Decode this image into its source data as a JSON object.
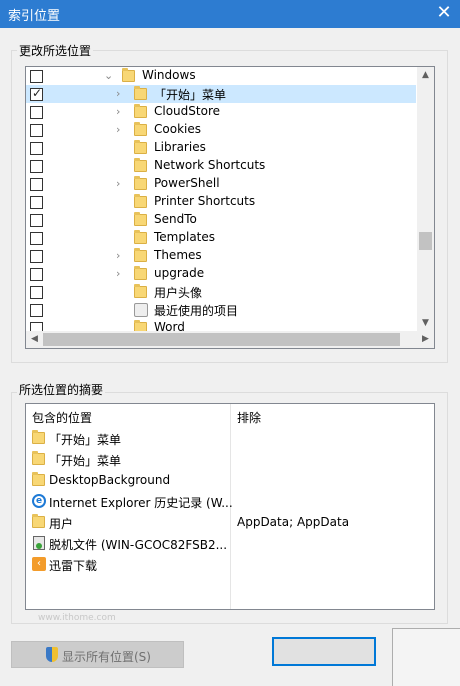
{
  "window": {
    "title": "索引位置",
    "close_glyph": "✕"
  },
  "change_section": {
    "label": "更改所选位置"
  },
  "tree": {
    "items": [
      {
        "label": "Windows",
        "checked": false,
        "expander": "⌄",
        "icon": "folder-icon"
      },
      {
        "label": "「开始」菜单",
        "checked": true,
        "expander": "›",
        "icon": "folder-icon"
      },
      {
        "label": "CloudStore",
        "checked": false,
        "expander": "›",
        "icon": "folder-icon"
      },
      {
        "label": "Cookies",
        "checked": false,
        "expander": "›",
        "icon": "folder-icon"
      },
      {
        "label": "Libraries",
        "checked": false,
        "expander": "",
        "icon": "folder-icon"
      },
      {
        "label": "Network Shortcuts",
        "checked": false,
        "expander": "",
        "icon": "folder-icon"
      },
      {
        "label": "PowerShell",
        "checked": false,
        "expander": "›",
        "icon": "folder-icon"
      },
      {
        "label": "Printer Shortcuts",
        "checked": false,
        "expander": "",
        "icon": "folder-icon"
      },
      {
        "label": "SendTo",
        "checked": false,
        "expander": "",
        "icon": "folder-icon"
      },
      {
        "label": "Templates",
        "checked": false,
        "expander": "",
        "icon": "folder-icon"
      },
      {
        "label": "Themes",
        "checked": false,
        "expander": "›",
        "icon": "folder-icon"
      },
      {
        "label": "upgrade",
        "checked": false,
        "expander": "›",
        "icon": "folder-icon"
      },
      {
        "label": "用户头像",
        "checked": false,
        "expander": "",
        "icon": "folder-icon"
      },
      {
        "label": "最近使用的项目",
        "checked": false,
        "expander": "",
        "icon": "recent-items-icon"
      },
      {
        "label": "Word",
        "checked": false,
        "expander": "",
        "icon": "folder-icon"
      }
    ],
    "scroll_up": "▲",
    "scroll_down": "▼",
    "scroll_left": "◀",
    "scroll_right": "▶"
  },
  "summary_section": {
    "label": "所选位置的摘要",
    "col_included": "包含的位置",
    "col_excluded": "排除",
    "rows": [
      {
        "location": "「开始」菜单",
        "exclude": "",
        "icon": "folder-icon"
      },
      {
        "location": "「开始」菜单",
        "exclude": "",
        "icon": "folder-icon"
      },
      {
        "location": "DesktopBackground",
        "exclude": "",
        "icon": "folder-icon"
      },
      {
        "location": "Internet Explorer 历史记录 (W...",
        "exclude": "",
        "icon": "ie-icon"
      },
      {
        "location": "用户",
        "exclude": "AppData; AppData",
        "icon": "folder-icon"
      },
      {
        "location": "脱机文件 (WIN-GCOC82FSB2...",
        "exclude": "",
        "icon": "offline-files-icon"
      },
      {
        "location": "迅雷下载",
        "exclude": "",
        "icon": "xunlei-icon"
      }
    ]
  },
  "watermark": "www.ithome.com",
  "buttons": {
    "show_all": "显示所有位置(S)",
    "ok": "",
    "cancel": ""
  }
}
